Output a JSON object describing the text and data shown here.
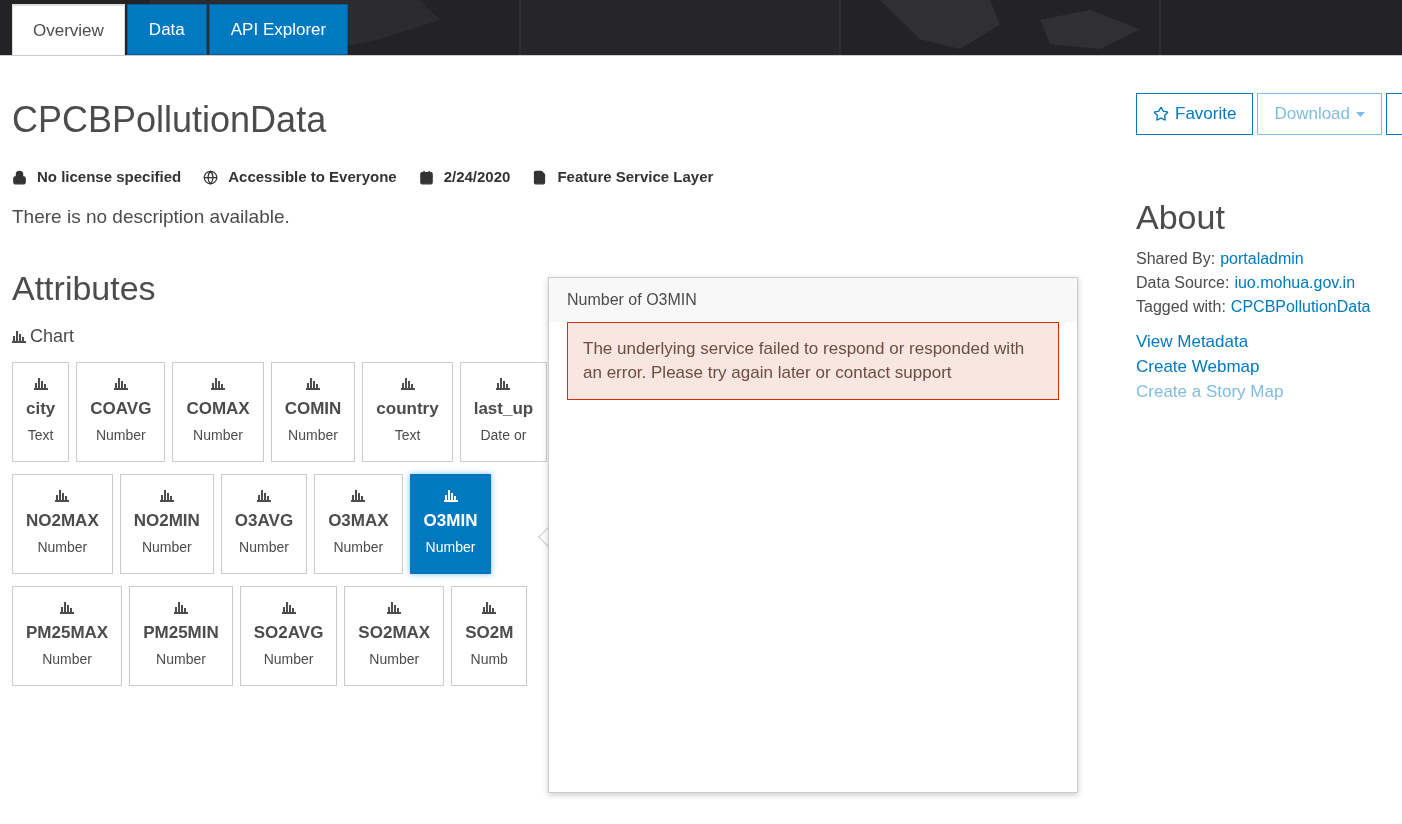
{
  "tabs": [
    {
      "label": "Overview",
      "selected": true
    },
    {
      "label": "Data",
      "selected": false
    },
    {
      "label": "API Explorer",
      "selected": false
    }
  ],
  "title": "CPCBPollutionData",
  "meta": [
    {
      "kind": "license",
      "text": "No license specified"
    },
    {
      "kind": "access",
      "text": "Accessible to Everyone"
    },
    {
      "kind": "date",
      "text": "2/24/2020"
    },
    {
      "kind": "type",
      "text": "Feature Service Layer"
    }
  ],
  "description": "There is no description available.",
  "attributes": {
    "heading": "Attributes",
    "chart_label": "Chart",
    "rows": [
      [
        {
          "name": "city",
          "type": "Text",
          "selected": false
        },
        {
          "name": "COAVG",
          "type": "Number",
          "selected": false
        },
        {
          "name": "COMAX",
          "type": "Number",
          "selected": false
        },
        {
          "name": "COMIN",
          "type": "Number",
          "selected": false
        },
        {
          "name": "country",
          "type": "Text",
          "selected": false
        },
        {
          "name": "last_up",
          "type": "Date or",
          "selected": false
        }
      ],
      [
        {
          "name": "NO2MAX",
          "type": "Number",
          "selected": false
        },
        {
          "name": "NO2MIN",
          "type": "Number",
          "selected": false
        },
        {
          "name": "O3AVG",
          "type": "Number",
          "selected": false
        },
        {
          "name": "O3MAX",
          "type": "Number",
          "selected": false
        },
        {
          "name": "O3MIN",
          "type": "Number",
          "selected": true
        }
      ],
      [
        {
          "name": "PM25MAX",
          "type": "Number",
          "selected": false
        },
        {
          "name": "PM25MIN",
          "type": "Number",
          "selected": false
        },
        {
          "name": "SO2AVG",
          "type": "Number",
          "selected": false
        },
        {
          "name": "SO2MAX",
          "type": "Number",
          "selected": false
        },
        {
          "name": "SO2M",
          "type": "Numb",
          "selected": false
        }
      ]
    ]
  },
  "popover": {
    "title": "Number of O3MIN",
    "error": "The underlying service failed to respond or responded with an error. Please try again later or contact support"
  },
  "actions": [
    {
      "kind": "favorite",
      "label": "Favorite",
      "disabled": false
    },
    {
      "kind": "download",
      "label": "Download",
      "disabled": true
    }
  ],
  "about": {
    "heading": "About",
    "details": [
      {
        "label": "Shared By:",
        "value": "portaladmin"
      },
      {
        "label": "Data Source:",
        "value": "iuo.mohua.gov.in"
      },
      {
        "label": "Tagged with:",
        "value": "CPCBPollutionData"
      }
    ],
    "links": [
      {
        "label": "View Metadata",
        "disabled": false
      },
      {
        "label": "Create Webmap",
        "disabled": false
      },
      {
        "label": "Create a Story Map",
        "disabled": true
      }
    ]
  }
}
